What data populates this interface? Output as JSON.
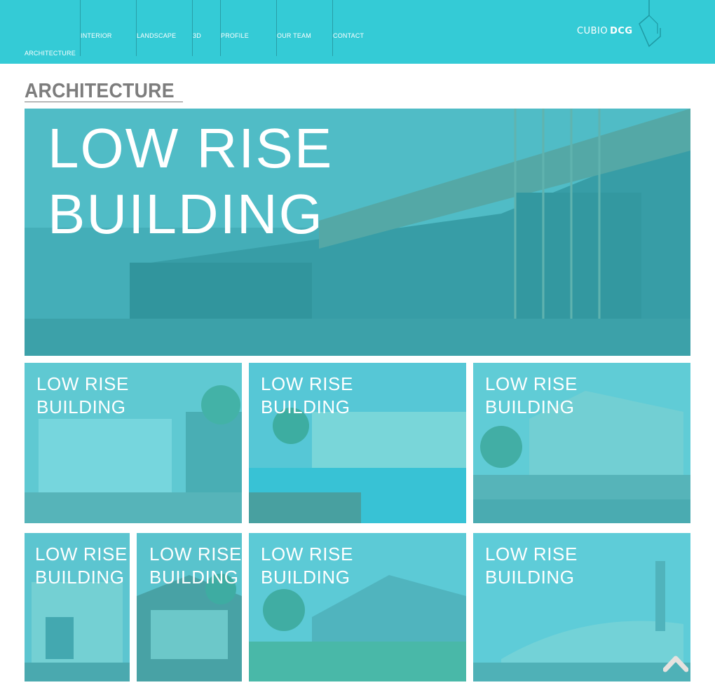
{
  "nav": {
    "items": [
      "ARCHITECTURE",
      "INTERIOR",
      "LANDSCAPE",
      "3D",
      "PROFILE",
      "OUR TEAM",
      "CONTACT"
    ]
  },
  "brand": {
    "name_light": "CUBIO",
    "name_bold": "DCG"
  },
  "section": {
    "title": "ARCHITECTURE"
  },
  "hero": {
    "line1": "LOW RISE",
    "line2": "BUILDING"
  },
  "tiles": [
    {
      "line1": "LOW RISE",
      "line2": "BUILDING"
    },
    {
      "line1": "LOW RISE",
      "line2": "BUILDING"
    },
    {
      "line1": "LOW RISE",
      "line2": "BUILDING"
    },
    {
      "line1": "LOW RISE",
      "line2": "BUILDING"
    },
    {
      "line1": "LOW RISE",
      "line2": "BUILDING"
    },
    {
      "line1": "LOW RISE",
      "line2": "BUILDING"
    },
    {
      "line1": "LOW RISE",
      "line2": "BUILDING"
    }
  ],
  "colors": {
    "accent": "#34cbd6",
    "title": "#7d7d7d"
  },
  "icons": {
    "scroll_top": "chevron-up-icon",
    "logo": "hexagon-logo-icon"
  }
}
